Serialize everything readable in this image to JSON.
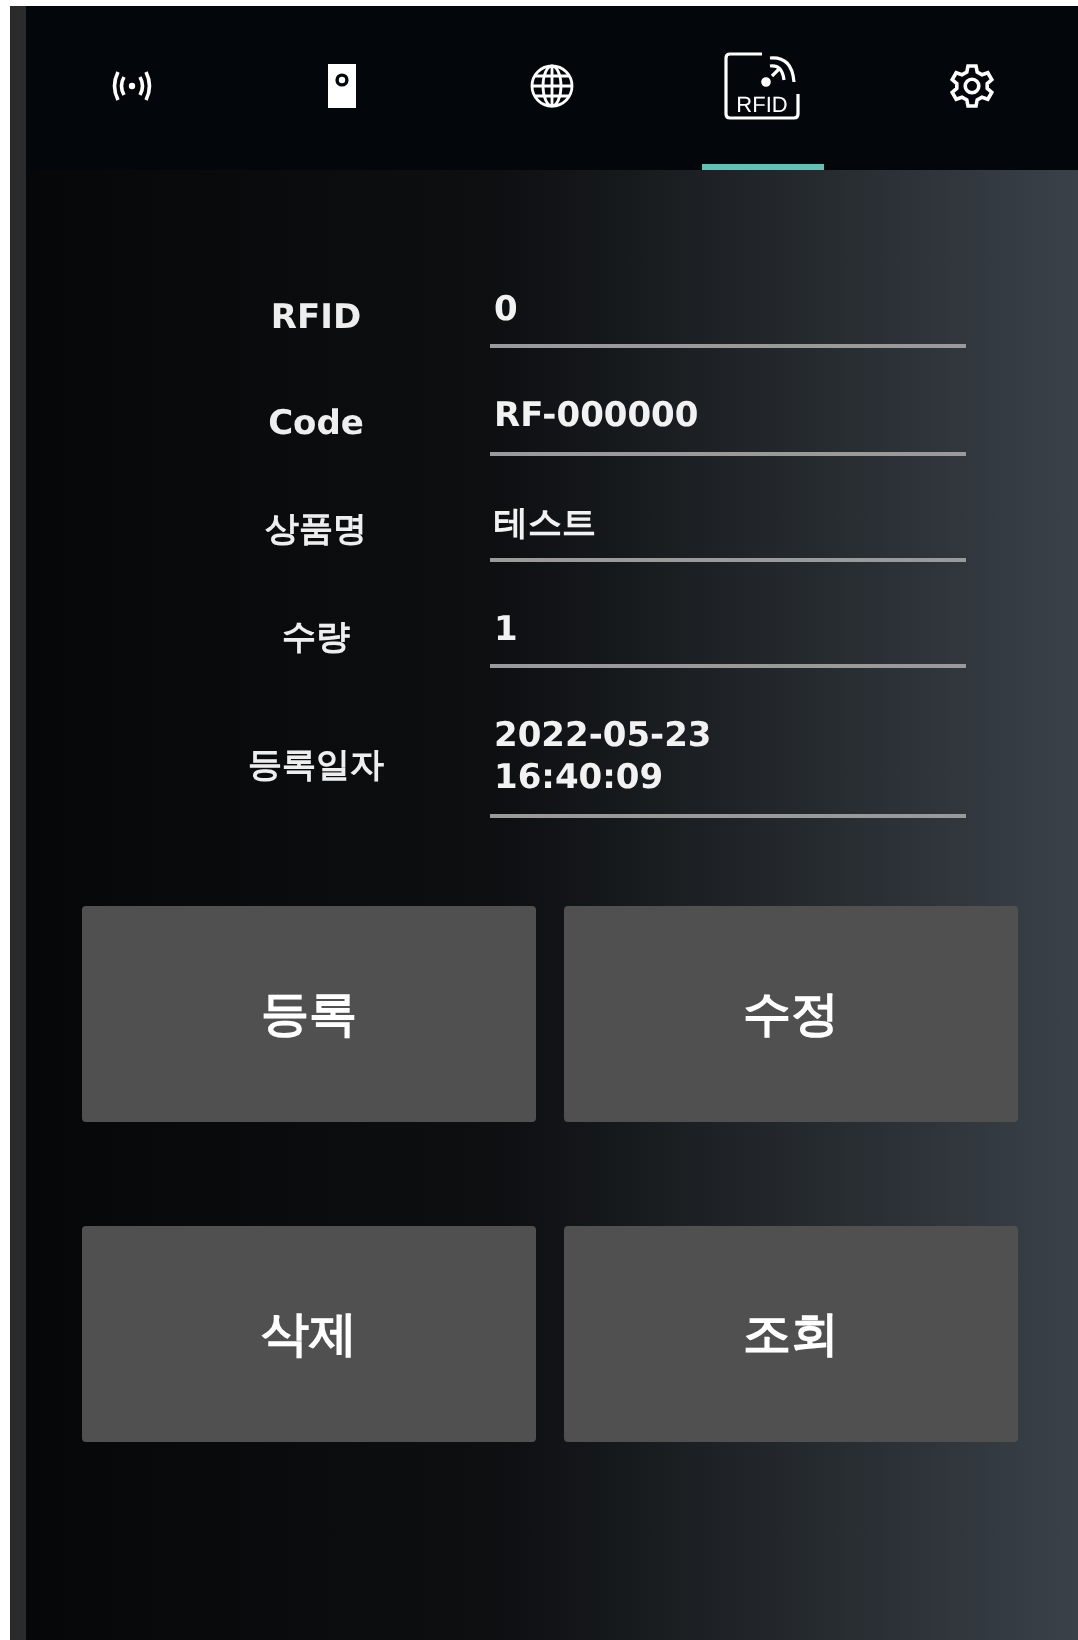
{
  "tabs": [
    {
      "kind": "signal",
      "selected": false
    },
    {
      "kind": "device",
      "selected": false
    },
    {
      "kind": "globe",
      "selected": false
    },
    {
      "kind": "rfid",
      "icon_text": "RFID",
      "selected": true
    },
    {
      "kind": "settings",
      "selected": false
    }
  ],
  "form": [
    {
      "label": "RFID",
      "value": "0"
    },
    {
      "label": "Code",
      "value": "RF-000000"
    },
    {
      "label": "상품명",
      "value": "테스트"
    },
    {
      "label": "수량",
      "value": "1"
    },
    {
      "label": "등록일자",
      "value": "2022-05-23\n16:40:09"
    }
  ],
  "buttons": [
    "등록",
    "수정",
    "삭제",
    "조회"
  ]
}
